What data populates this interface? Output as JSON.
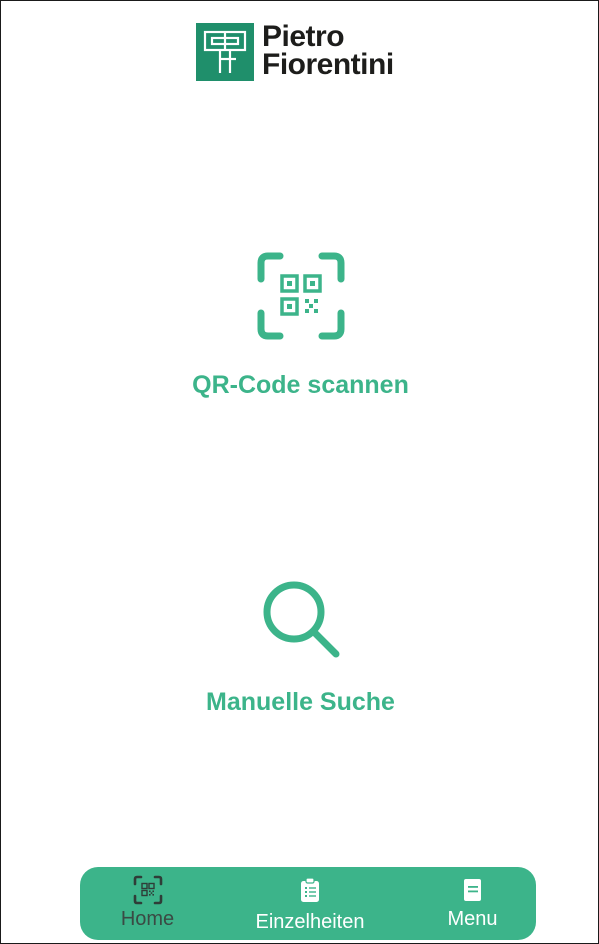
{
  "brand": {
    "line1": "Pietro",
    "line2": "Fiorentini",
    "logo_icon": "pietro-fiorentini-logo",
    "color": "#1f8f6b"
  },
  "actions": {
    "scan": {
      "label": "QR-Code scannen",
      "icon": "qr-scan-icon"
    },
    "search": {
      "label": "Manuelle Suche",
      "icon": "search-icon"
    }
  },
  "nav": {
    "background": "#3cb48a",
    "items": [
      {
        "label": "Home",
        "icon": "qr-scan-icon",
        "active": true
      },
      {
        "label": "Einzelheiten",
        "icon": "clipboard-icon",
        "active": false
      },
      {
        "label": "Menu",
        "icon": "document-icon",
        "active": false
      }
    ]
  },
  "colors": {
    "accent": "#3cb48a",
    "text_dark": "#1d1d1b"
  }
}
